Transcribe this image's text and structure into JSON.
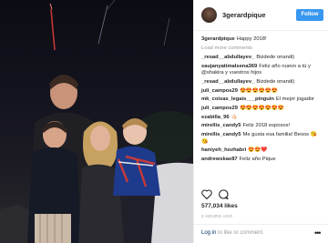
{
  "post": {
    "username": "3gerardpique",
    "follow_label": "Follow",
    "caption_user": "3gerardpique",
    "caption_text": "Happy 2018!",
    "load_more": "Load more comments",
    "comments": [
      {
        "user": "_resad__abdullayev_",
        "text": "Bizdede onandi)"
      },
      {
        "user": "saujanyatimalsena369",
        "text": "Feliz año nuevo a tú y @shakira y vuestros hijos"
      },
      {
        "user": "_resad__abdullayev_",
        "text": "Bizdede onandi)"
      },
      {
        "user": "juli_campos29",
        "text": "😍😍😍😍😍😍"
      },
      {
        "user": "mk_coisas_legais___pinguin",
        "text": "El mejor jogador"
      },
      {
        "user": "juli_campos29",
        "text": "😍😍😍😍😍😍😍"
      },
      {
        "user": "ezabilla_96",
        "text": "🤙🏻"
      },
      {
        "user": "mirellis_candy5",
        "text": "Feliz 2018 esposos!"
      },
      {
        "user": "mirellis_candy5",
        "text": "Me gusta esa familia! Besos 😘😘"
      },
      {
        "user": "haniyeh_hozhabri",
        "text": "😍😍❤️"
      },
      {
        "user": "andrewskae87",
        "text": "Feliz año Pique"
      }
    ],
    "likes": "577,034 likes",
    "time_ago": "3 HOURS AGO",
    "login_link": "Log in",
    "login_rest": " to like or comment.",
    "more_label": "•••"
  },
  "colors": {
    "follow_blue": "#3897f0",
    "username_dark": "#262626",
    "muted": "#999999"
  },
  "icons": [
    "heart-icon",
    "comment-icon",
    "more-options-icon"
  ]
}
